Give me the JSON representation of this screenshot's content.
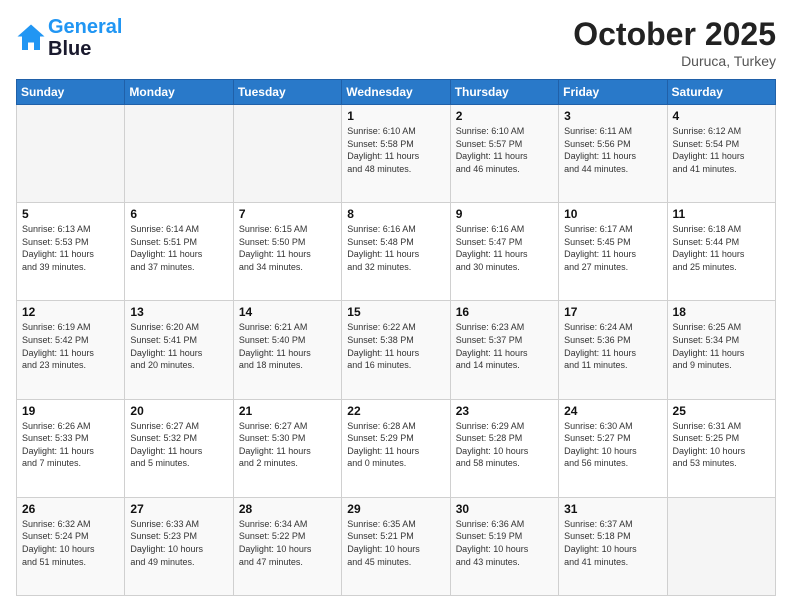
{
  "header": {
    "logo_line1": "General",
    "logo_line2": "Blue",
    "month": "October 2025",
    "location": "Duruca, Turkey"
  },
  "days_of_week": [
    "Sunday",
    "Monday",
    "Tuesday",
    "Wednesday",
    "Thursday",
    "Friday",
    "Saturday"
  ],
  "weeks": [
    [
      {
        "day": "",
        "info": ""
      },
      {
        "day": "",
        "info": ""
      },
      {
        "day": "",
        "info": ""
      },
      {
        "day": "1",
        "info": "Sunrise: 6:10 AM\nSunset: 5:58 PM\nDaylight: 11 hours\nand 48 minutes."
      },
      {
        "day": "2",
        "info": "Sunrise: 6:10 AM\nSunset: 5:57 PM\nDaylight: 11 hours\nand 46 minutes."
      },
      {
        "day": "3",
        "info": "Sunrise: 6:11 AM\nSunset: 5:56 PM\nDaylight: 11 hours\nand 44 minutes."
      },
      {
        "day": "4",
        "info": "Sunrise: 6:12 AM\nSunset: 5:54 PM\nDaylight: 11 hours\nand 41 minutes."
      }
    ],
    [
      {
        "day": "5",
        "info": "Sunrise: 6:13 AM\nSunset: 5:53 PM\nDaylight: 11 hours\nand 39 minutes."
      },
      {
        "day": "6",
        "info": "Sunrise: 6:14 AM\nSunset: 5:51 PM\nDaylight: 11 hours\nand 37 minutes."
      },
      {
        "day": "7",
        "info": "Sunrise: 6:15 AM\nSunset: 5:50 PM\nDaylight: 11 hours\nand 34 minutes."
      },
      {
        "day": "8",
        "info": "Sunrise: 6:16 AM\nSunset: 5:48 PM\nDaylight: 11 hours\nand 32 minutes."
      },
      {
        "day": "9",
        "info": "Sunrise: 6:16 AM\nSunset: 5:47 PM\nDaylight: 11 hours\nand 30 minutes."
      },
      {
        "day": "10",
        "info": "Sunrise: 6:17 AM\nSunset: 5:45 PM\nDaylight: 11 hours\nand 27 minutes."
      },
      {
        "day": "11",
        "info": "Sunrise: 6:18 AM\nSunset: 5:44 PM\nDaylight: 11 hours\nand 25 minutes."
      }
    ],
    [
      {
        "day": "12",
        "info": "Sunrise: 6:19 AM\nSunset: 5:42 PM\nDaylight: 11 hours\nand 23 minutes."
      },
      {
        "day": "13",
        "info": "Sunrise: 6:20 AM\nSunset: 5:41 PM\nDaylight: 11 hours\nand 20 minutes."
      },
      {
        "day": "14",
        "info": "Sunrise: 6:21 AM\nSunset: 5:40 PM\nDaylight: 11 hours\nand 18 minutes."
      },
      {
        "day": "15",
        "info": "Sunrise: 6:22 AM\nSunset: 5:38 PM\nDaylight: 11 hours\nand 16 minutes."
      },
      {
        "day": "16",
        "info": "Sunrise: 6:23 AM\nSunset: 5:37 PM\nDaylight: 11 hours\nand 14 minutes."
      },
      {
        "day": "17",
        "info": "Sunrise: 6:24 AM\nSunset: 5:36 PM\nDaylight: 11 hours\nand 11 minutes."
      },
      {
        "day": "18",
        "info": "Sunrise: 6:25 AM\nSunset: 5:34 PM\nDaylight: 11 hours\nand 9 minutes."
      }
    ],
    [
      {
        "day": "19",
        "info": "Sunrise: 6:26 AM\nSunset: 5:33 PM\nDaylight: 11 hours\nand 7 minutes."
      },
      {
        "day": "20",
        "info": "Sunrise: 6:27 AM\nSunset: 5:32 PM\nDaylight: 11 hours\nand 5 minutes."
      },
      {
        "day": "21",
        "info": "Sunrise: 6:27 AM\nSunset: 5:30 PM\nDaylight: 11 hours\nand 2 minutes."
      },
      {
        "day": "22",
        "info": "Sunrise: 6:28 AM\nSunset: 5:29 PM\nDaylight: 11 hours\nand 0 minutes."
      },
      {
        "day": "23",
        "info": "Sunrise: 6:29 AM\nSunset: 5:28 PM\nDaylight: 10 hours\nand 58 minutes."
      },
      {
        "day": "24",
        "info": "Sunrise: 6:30 AM\nSunset: 5:27 PM\nDaylight: 10 hours\nand 56 minutes."
      },
      {
        "day": "25",
        "info": "Sunrise: 6:31 AM\nSunset: 5:25 PM\nDaylight: 10 hours\nand 53 minutes."
      }
    ],
    [
      {
        "day": "26",
        "info": "Sunrise: 6:32 AM\nSunset: 5:24 PM\nDaylight: 10 hours\nand 51 minutes."
      },
      {
        "day": "27",
        "info": "Sunrise: 6:33 AM\nSunset: 5:23 PM\nDaylight: 10 hours\nand 49 minutes."
      },
      {
        "day": "28",
        "info": "Sunrise: 6:34 AM\nSunset: 5:22 PM\nDaylight: 10 hours\nand 47 minutes."
      },
      {
        "day": "29",
        "info": "Sunrise: 6:35 AM\nSunset: 5:21 PM\nDaylight: 10 hours\nand 45 minutes."
      },
      {
        "day": "30",
        "info": "Sunrise: 6:36 AM\nSunset: 5:19 PM\nDaylight: 10 hours\nand 43 minutes."
      },
      {
        "day": "31",
        "info": "Sunrise: 6:37 AM\nSunset: 5:18 PM\nDaylight: 10 hours\nand 41 minutes."
      },
      {
        "day": "",
        "info": ""
      }
    ]
  ]
}
